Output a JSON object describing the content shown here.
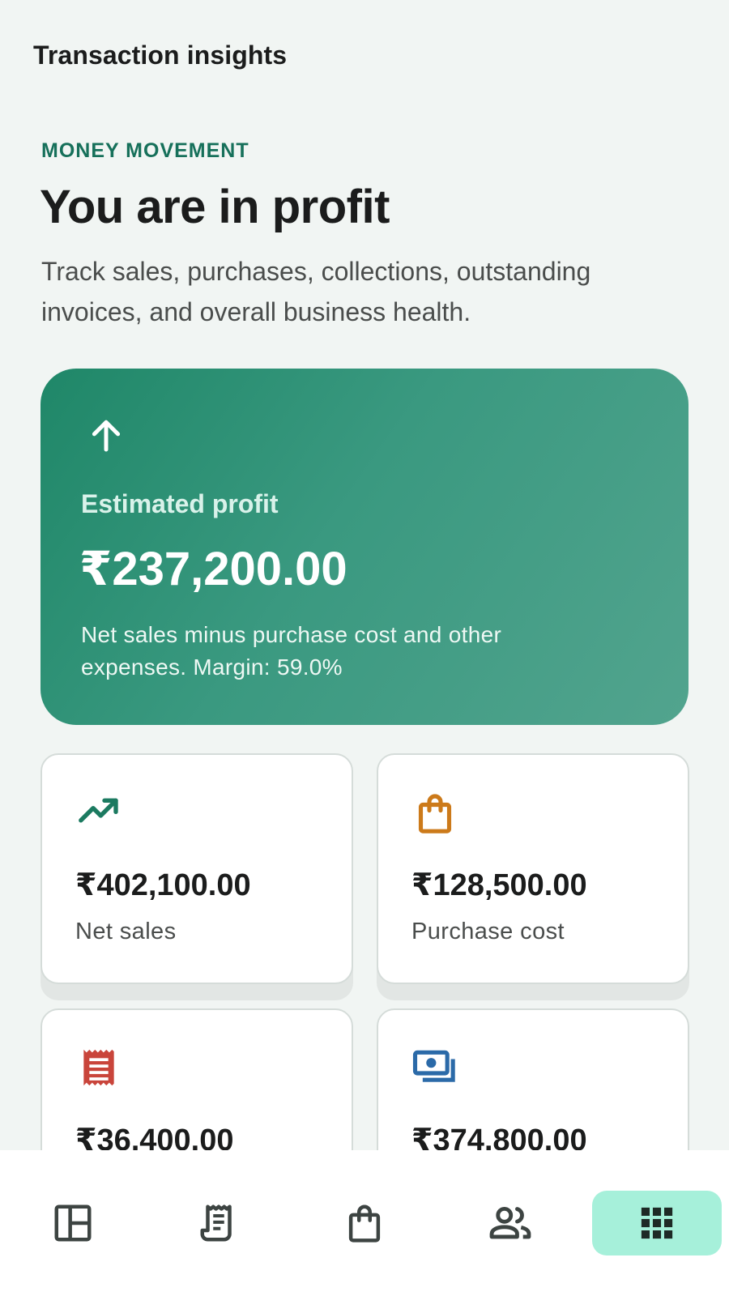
{
  "app_bar": {
    "title": "Transaction insights"
  },
  "header": {
    "eyebrow": "MONEY MOVEMENT",
    "headline": "You are in profit",
    "subtitle": "Track sales, purchases, collections, outstanding invoices, and overall business health."
  },
  "hero": {
    "icon": "arrow-up-icon",
    "label": "Estimated profit",
    "value": "₹237,200.00",
    "description": "Net sales minus purchase cost and other expenses. Margin: 59.0%"
  },
  "cards": [
    {
      "icon": "trending-up-icon",
      "value": "₹402,100.00",
      "label": "Net sales",
      "color": "#1b7a60"
    },
    {
      "icon": "shopping-bag-icon",
      "value": "₹128,500.00",
      "label": "Purchase cost",
      "color": "#cc7a1a"
    },
    {
      "icon": "receipt-icon",
      "value": "₹36,400.00",
      "label": "",
      "color": "#c9453b"
    },
    {
      "icon": "payments-icon",
      "value": "₹374,800.00",
      "label": "",
      "color": "#2b6aa8"
    }
  ],
  "nav": {
    "items": [
      {
        "icon": "dashboard-icon"
      },
      {
        "icon": "receipt-long-icon"
      },
      {
        "icon": "shopping-bag-icon"
      },
      {
        "icon": "people-icon"
      },
      {
        "icon": "apps-grid-icon",
        "active": true
      }
    ]
  },
  "colors": {
    "background": "#f1f5f3",
    "primary": "#16705a",
    "hero_start": "#1f8768",
    "hero_end": "#52a48e",
    "nav_active": "#a6f0da"
  }
}
